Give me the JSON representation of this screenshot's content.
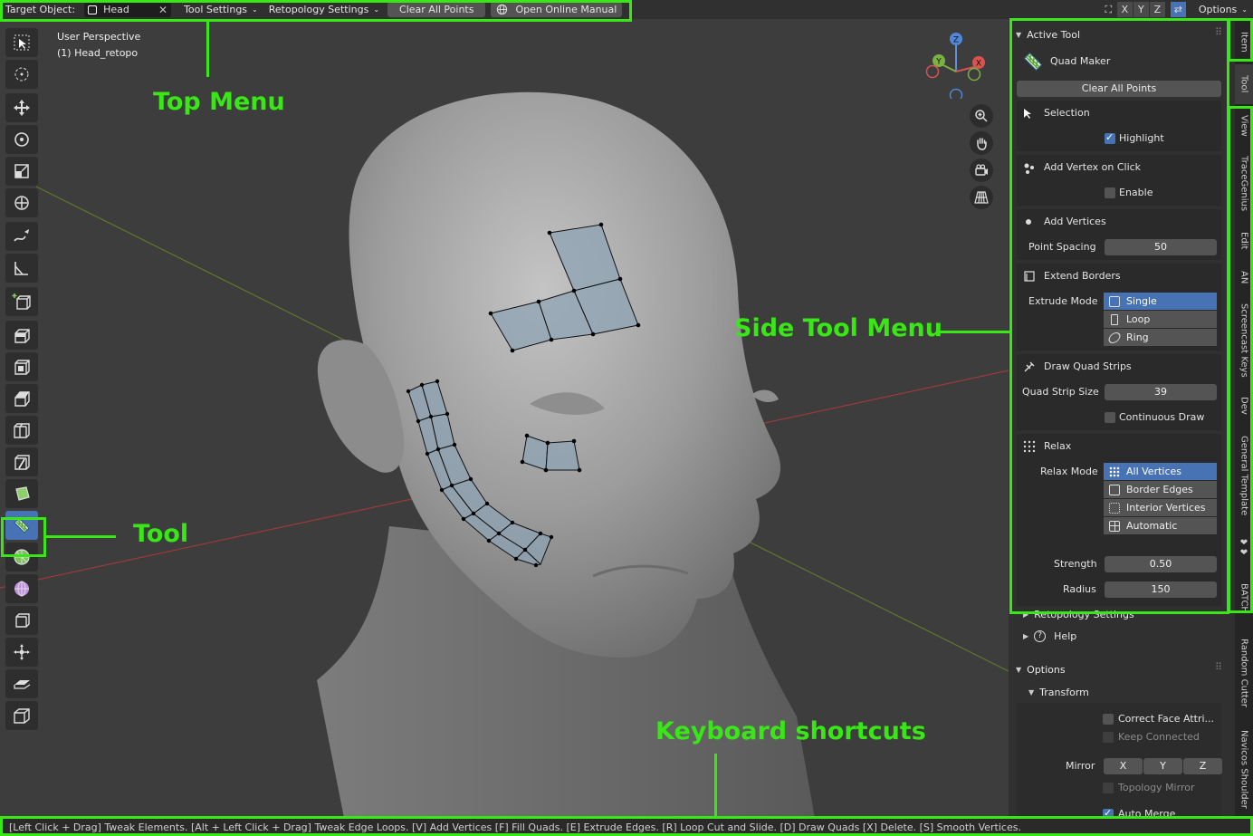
{
  "header": {
    "target_label": "Target Object:",
    "target_value": "Head",
    "tool_settings": "Tool Settings",
    "retopo_settings": "Retopology Settings",
    "clear_points": "Clear All Points",
    "manual": "Open Online Manual",
    "axis_x": "X",
    "axis_y": "Y",
    "axis_z": "Z",
    "options": "Options"
  },
  "viewport": {
    "perspective": "User Perspective",
    "object": "(1) Head_retopo",
    "gizmo_x": "X",
    "gizmo_y": "Y",
    "gizmo_z": "Z"
  },
  "panel": {
    "active_tool_header": "Active Tool",
    "tool_name": "Quad Maker",
    "clear_all": "Clear All Points",
    "selection": "Selection",
    "highlight": "Highlight",
    "add_vertex_click": "Add Vertex on Click",
    "enable": "Enable",
    "add_vertices": "Add Vertices",
    "point_spacing_label": "Point Spacing",
    "point_spacing": "50",
    "extend_borders": "Extend Borders",
    "extrude_mode_label": "Extrude Mode",
    "extrude_modes": [
      "Single",
      "Loop",
      "Ring"
    ],
    "draw_quad_strips": "Draw Quad Strips",
    "quad_strip_label": "Quad Strip Size",
    "quad_strip_size": "39",
    "continuous_draw": "Continuous Draw",
    "relax": "Relax",
    "relax_mode_label": "Relax Mode",
    "relax_modes": [
      "All Vertices",
      "Border Edges",
      "Interior Vertices",
      "Automatic"
    ],
    "strength_label": "Strength",
    "strength": "0.50",
    "radius_label": "Radius",
    "radius": "150",
    "retopo_settings": "Retopology Settings",
    "help": "Help",
    "options_header": "Options",
    "transform": "Transform",
    "correct_face": "Correct Face Attri...",
    "keep_connected": "Keep Connected",
    "mirror_label": "Mirror",
    "mirror_x": "X",
    "mirror_y": "Y",
    "mirror_z": "Z",
    "topology_mirror": "Topology Mirror",
    "auto_merge": "Auto Merge"
  },
  "tabs": [
    "Item",
    "Tool",
    "View",
    "TraceGenius",
    "Edit",
    "AN",
    "Screencast Keys",
    "Dev",
    "General Template",
    "❤❤",
    "BATCH",
    "Random Cutter",
    "Navicos Shoulder"
  ],
  "status": "[Left Click + Drag] Tweak Elements.    [Alt + Left Click + Drag] Tweak Edge Loops.    [V] Add Vertices    [F] Fill Quads.    [E] Extrude Edges.    [R] Loop Cut and Slide.    [D] Draw Quads    [X] Delete.    [S] Smooth Vertices.",
  "annotations": {
    "top_menu": "Top Menu",
    "tool": "Tool",
    "side_tool_menu": "Side Tool Menu",
    "keyboard_shortcuts": "Keyboard shortcuts"
  },
  "colors": {
    "annotation": "#39e616",
    "accent": "#4772b3",
    "panel_bg": "#303030",
    "viewport_bg": "#3d3d3d"
  }
}
